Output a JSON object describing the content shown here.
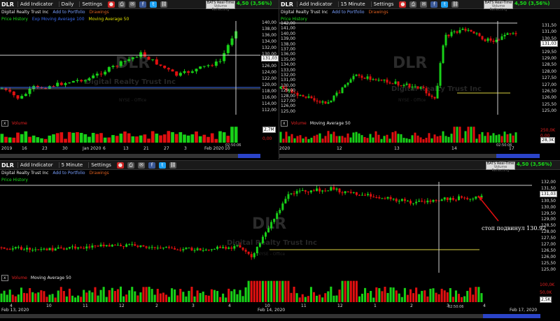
{
  "common": {
    "symbol": "DLR",
    "add_indicator": "Add Indicator",
    "settings": "Settings",
    "company": "Digital Realty Trust Inc",
    "add_portfolio": "Add to Portfolio",
    "drawings": "Drawings",
    "realtime_1": "BATS Real-Time",
    "realtime_2": "Volume Reflecting",
    "change": "4,50 (3,56%)",
    "price_history": "Price History",
    "volume": "Volume",
    "volume_ma": "Moving Average 50",
    "price_box": "131,03",
    "watermark": "DLR",
    "watermark_company": "Digital Realty Trust Inc",
    "watermark_sub": "NYSE - Office",
    "colors": {
      "up": "#18d018",
      "down": "#e01010",
      "accent": "#3a6cf0",
      "ma": "#e0e000"
    }
  },
  "pane_daily": {
    "interval": "Daily",
    "ma_label": "Exp Moving Average 100",
    "ma50": "Moving Average 50",
    "y_ticks": [
      "140,00",
      "138,00",
      "136,00",
      "134,00",
      "132,00",
      "130,00",
      "128,00",
      "126,00",
      "124,00",
      "122,00",
      "120,00",
      "118,00",
      "116,00",
      "114,00",
      "112,00"
    ],
    "x_ticks": [
      "2019",
      "16",
      "23",
      "30",
      "Jan 2020",
      "6",
      "13",
      "21",
      "27",
      "3",
      "Feb 2020",
      "10"
    ],
    "vol_box": "2,7M",
    "vol_zero": "0,00",
    "time": "02:50:06"
  },
  "pane_15m": {
    "interval": "15 Minute",
    "y_ticks": [
      "142,00",
      "141,00",
      "140,00",
      "139,00",
      "138,00",
      "137,00",
      "136,00",
      "135,00",
      "134,00",
      "133,00",
      "132,00",
      "131,00",
      "130,00",
      "129,00",
      "128,00",
      "127,00",
      "126,00",
      "125,00"
    ],
    "y_ticks_right": [
      "131,50",
      "131,00",
      "130,50",
      "130,00",
      "129,50",
      "129,00",
      "128,50",
      "128,00",
      "127,50",
      "127,00",
      "126,50",
      "126,00",
      "125,50",
      "125,00"
    ],
    "x_ticks": [
      "2020",
      "12",
      "13",
      "14",
      "17"
    ],
    "vol_box": "28,3K",
    "vol_top": "250,0K",
    "vol_mid": "0,00",
    "time": "02:50:06"
  },
  "pane_5m": {
    "interval": "5 Minute",
    "y_ticks": [
      "132,00",
      "131,50",
      "131,00",
      "130,50",
      "130,00",
      "129,50",
      "129,00",
      "128,50",
      "128,00",
      "127,50",
      "127,00",
      "126,50",
      "126,00",
      "125,50",
      "125,00"
    ],
    "x_ticks": [
      "4",
      "10",
      "11",
      "12",
      "2",
      "3",
      "4",
      "10",
      "11",
      "12",
      "1",
      "2",
      "3",
      "4"
    ],
    "date_left": "Feb 13, 2020",
    "date_mid": "Feb 14, 2020",
    "date_right": "Feb 17, 2020",
    "vol_box": "2,5K",
    "vol_top": "100,0K",
    "vol_mid": "50,0K",
    "time": "02:50:06",
    "annotation": "стоп подвинул 130.92"
  }
}
